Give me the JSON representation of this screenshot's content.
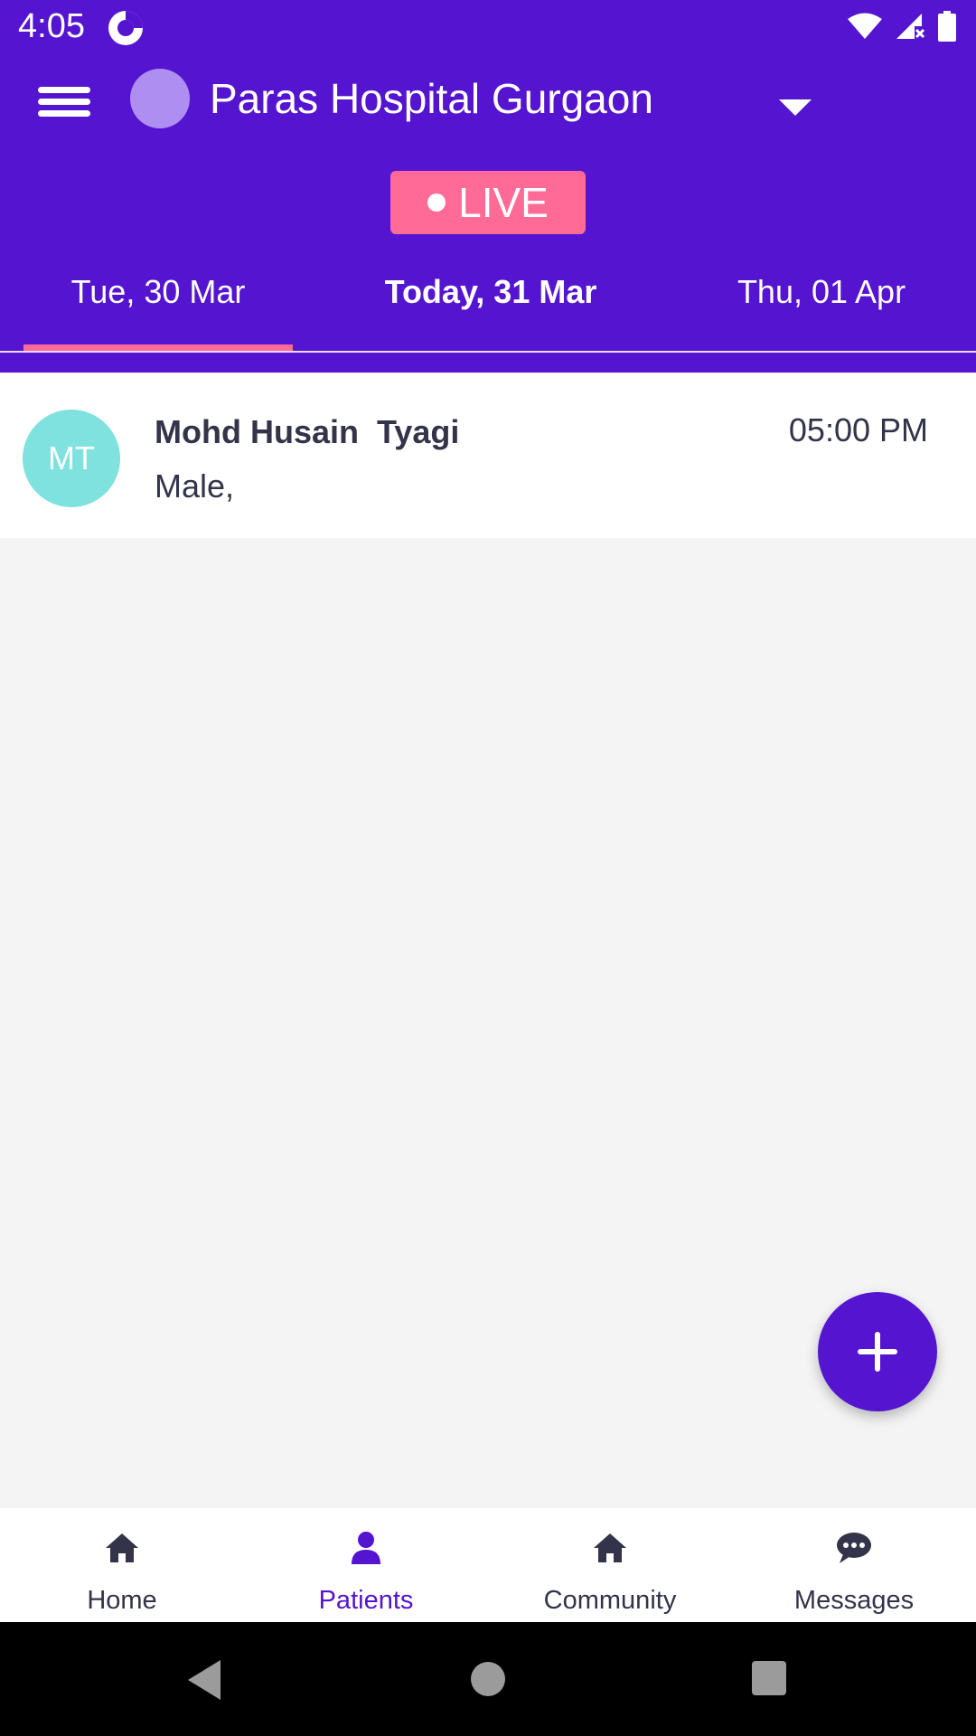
{
  "status_bar": {
    "time": "4:05"
  },
  "header": {
    "hospital_name": "Paras Hospital Gurgaon",
    "live_label": "LIVE",
    "brand_color": "#5414d0",
    "accent_color": "#ff6b96"
  },
  "date_tabs": [
    {
      "label": "Tue, 30 Mar",
      "selected": true
    },
    {
      "label": "Today, 31 Mar",
      "selected": false
    },
    {
      "label": "Thu, 01 Apr",
      "selected": false
    }
  ],
  "appointments": [
    {
      "initials": "MT",
      "name": "Mohd Husain  Tyagi",
      "gender": "Male,",
      "time": "05:00 PM",
      "avatar_color": "#7fe2de"
    }
  ],
  "bottom_nav": [
    {
      "label": "Home",
      "icon": "home-icon",
      "active": false
    },
    {
      "label": "Patients",
      "icon": "person-icon",
      "active": true
    },
    {
      "label": "Community",
      "icon": "home-icon",
      "active": false
    },
    {
      "label": "Messages",
      "icon": "chat-bubble-icon",
      "active": false
    }
  ]
}
